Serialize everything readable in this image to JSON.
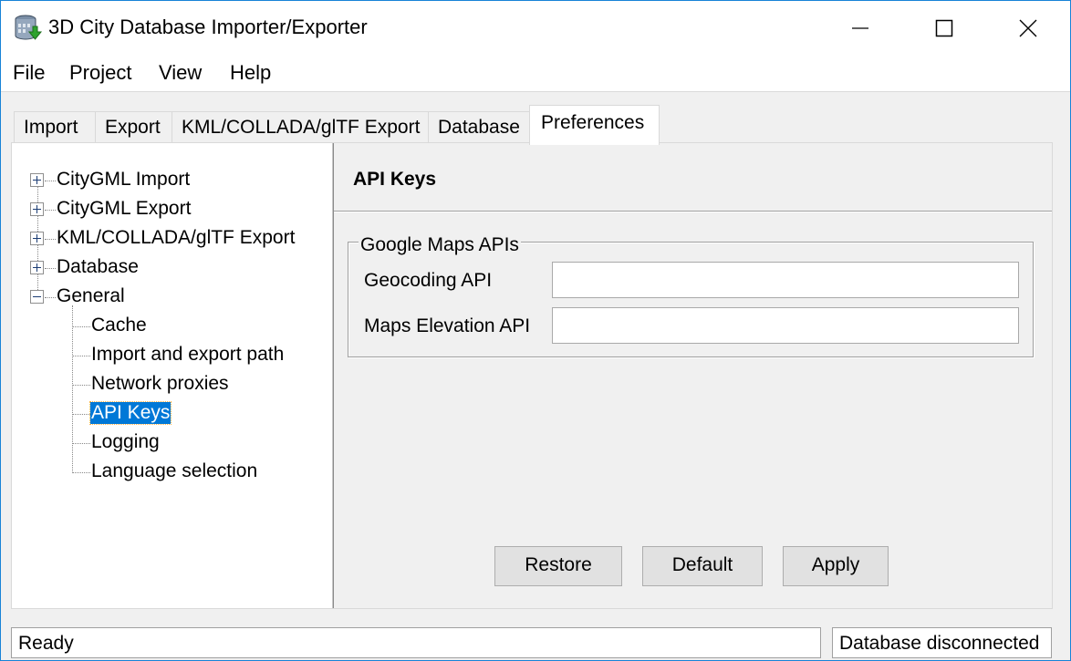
{
  "window": {
    "title": "3D City Database Importer/Exporter",
    "app_icon": "database-icon"
  },
  "menu": [
    "File",
    "Project",
    "View",
    "Help"
  ],
  "tabs": [
    "Import",
    "Export",
    "KML/COLLADA/glTF Export",
    "Database",
    "Preferences"
  ],
  "active_tab": "Preferences",
  "tree": {
    "top_level": [
      "CityGML Import",
      "CityGML Export",
      "KML/COLLADA/glTF Export",
      "Database",
      "General"
    ],
    "general_children": [
      "Cache",
      "Import and export path",
      "Network proxies",
      "API Keys",
      "Logging",
      "Language selection"
    ],
    "selected": "API Keys"
  },
  "panel": {
    "title": "API Keys",
    "group_title": "Google Maps APIs",
    "fields": [
      {
        "label": "Geocoding API",
        "value": ""
      },
      {
        "label": "Maps Elevation API",
        "value": ""
      }
    ],
    "buttons": {
      "restore": "Restore",
      "default": "Default",
      "apply": "Apply"
    }
  },
  "status": {
    "left": "Ready",
    "right": "Database disconnected"
  }
}
